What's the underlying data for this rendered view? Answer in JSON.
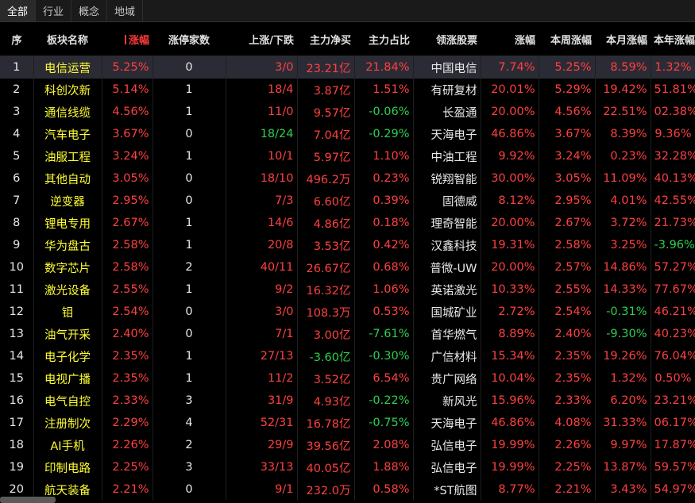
{
  "tabs": [
    {
      "label": "全部",
      "active": true
    },
    {
      "label": "行业",
      "active": false
    },
    {
      "label": "概念",
      "active": false
    },
    {
      "label": "地域",
      "active": false
    }
  ],
  "headers": [
    "序",
    "板块名称",
    "涨幅",
    "涨停家数",
    "上涨/下跌",
    "主力净买",
    "主力占比",
    "领涨股票",
    "涨幅",
    "本周涨幅",
    "本月涨幅",
    "本年涨幅"
  ],
  "rows": [
    {
      "idx": "1",
      "name": "电信运营",
      "chg": "5.25%",
      "limit": "0",
      "updown": "3/0",
      "net": "23.21亿",
      "ratio": "21.84%",
      "leader": "中国电信",
      "lchg": "7.74%",
      "week": "5.25%",
      "month": "8.59%",
      "year": "1.32%"
    },
    {
      "idx": "2",
      "name": "科创次新",
      "chg": "5.14%",
      "limit": "1",
      "updown": "18/4",
      "net": "3.87亿",
      "ratio": "1.51%",
      "leader": "有研复材",
      "lchg": "20.01%",
      "week": "5.29%",
      "month": "19.42%",
      "year": "51.81%"
    },
    {
      "idx": "3",
      "name": "通信线缆",
      "chg": "4.56%",
      "limit": "1",
      "updown": "11/0",
      "net": "9.57亿",
      "ratio": "-0.06%",
      "leader": "长盈通",
      "lchg": "20.00%",
      "week": "4.56%",
      "month": "22.51%",
      "year": "02.38%"
    },
    {
      "idx": "4",
      "name": "汽车电子",
      "chg": "3.67%",
      "limit": "0",
      "updown": "18/24",
      "net": "7.04亿",
      "ratio": "-0.29%",
      "leader": "天海电子",
      "lchg": "46.86%",
      "week": "3.67%",
      "month": "8.39%",
      "year": "9.36%"
    },
    {
      "idx": "5",
      "name": "油服工程",
      "chg": "3.24%",
      "limit": "1",
      "updown": "10/1",
      "net": "5.97亿",
      "ratio": "1.10%",
      "leader": "中油工程",
      "lchg": "9.92%",
      "week": "3.24%",
      "month": "0.23%",
      "year": "32.28%"
    },
    {
      "idx": "6",
      "name": "其他自动",
      "chg": "3.05%",
      "limit": "0",
      "updown": "18/10",
      "net": "496.2万",
      "ratio": "0.23%",
      "leader": "锐翔智能",
      "lchg": "30.00%",
      "week": "3.05%",
      "month": "11.09%",
      "year": "40.13%"
    },
    {
      "idx": "7",
      "name": "逆变器",
      "chg": "2.95%",
      "limit": "0",
      "updown": "7/3",
      "net": "6.60亿",
      "ratio": "0.39%",
      "leader": "固德威",
      "lchg": "8.12%",
      "week": "2.95%",
      "month": "4.01%",
      "year": "42.55%"
    },
    {
      "idx": "8",
      "name": "锂电专用",
      "chg": "2.67%",
      "limit": "1",
      "updown": "14/6",
      "net": "4.86亿",
      "ratio": "0.18%",
      "leader": "理奇智能",
      "lchg": "20.00%",
      "week": "2.67%",
      "month": "3.72%",
      "year": "21.73%"
    },
    {
      "idx": "9",
      "name": "华为盘古",
      "chg": "2.58%",
      "limit": "1",
      "updown": "20/8",
      "net": "3.53亿",
      "ratio": "0.42%",
      "leader": "汉鑫科技",
      "lchg": "19.31%",
      "week": "2.58%",
      "month": "3.25%",
      "year": "-3.96%"
    },
    {
      "idx": "10",
      "name": "数字芯片",
      "chg": "2.58%",
      "limit": "2",
      "updown": "40/11",
      "net": "26.67亿",
      "ratio": "0.68%",
      "leader": "普微-UW",
      "lchg": "20.00%",
      "week": "2.57%",
      "month": "14.86%",
      "year": "57.27%"
    },
    {
      "idx": "11",
      "name": "激光设备",
      "chg": "2.55%",
      "limit": "1",
      "updown": "9/2",
      "net": "16.32亿",
      "ratio": "1.06%",
      "leader": "英诺激光",
      "lchg": "10.33%",
      "week": "2.55%",
      "month": "14.33%",
      "year": "77.67%"
    },
    {
      "idx": "12",
      "name": "钼",
      "chg": "2.54%",
      "limit": "0",
      "updown": "3/0",
      "net": "108.3万",
      "ratio": "0.53%",
      "leader": "国城矿业",
      "lchg": "2.72%",
      "week": "2.54%",
      "month": "-0.31%",
      "year": "46.21%"
    },
    {
      "idx": "13",
      "name": "油气开采",
      "chg": "2.40%",
      "limit": "0",
      "updown": "7/1",
      "net": "3.00亿",
      "ratio": "-7.61%",
      "leader": "首华燃气",
      "lchg": "8.89%",
      "week": "2.40%",
      "month": "-9.30%",
      "year": "40.23%"
    },
    {
      "idx": "14",
      "name": "电子化学",
      "chg": "2.35%",
      "limit": "1",
      "updown": "27/13",
      "net": "-3.60亿",
      "ratio": "-0.30%",
      "leader": "广信材料",
      "lchg": "15.34%",
      "week": "2.35%",
      "month": "19.26%",
      "year": "76.04%"
    },
    {
      "idx": "15",
      "name": "电视广播",
      "chg": "2.35%",
      "limit": "1",
      "updown": "11/2",
      "net": "3.52亿",
      "ratio": "6.54%",
      "leader": "贵广网络",
      "lchg": "10.04%",
      "week": "2.35%",
      "month": "1.32%",
      "year": "0.50%"
    },
    {
      "idx": "16",
      "name": "电气自控",
      "chg": "2.33%",
      "limit": "3",
      "updown": "31/9",
      "net": "4.93亿",
      "ratio": "-0.22%",
      "leader": "新风光",
      "lchg": "15.96%",
      "week": "2.33%",
      "month": "6.20%",
      "year": "23.21%"
    },
    {
      "idx": "17",
      "name": "注册制次",
      "chg": "2.29%",
      "limit": "4",
      "updown": "52/31",
      "net": "16.78亿",
      "ratio": "-0.75%",
      "leader": "天海电子",
      "lchg": "46.86%",
      "week": "4.08%",
      "month": "31.33%",
      "year": "06.17%"
    },
    {
      "idx": "18",
      "name": "AI手机",
      "chg": "2.26%",
      "limit": "2",
      "updown": "29/9",
      "net": "39.56亿",
      "ratio": "2.08%",
      "leader": "弘信电子",
      "lchg": "19.99%",
      "week": "2.26%",
      "month": "9.97%",
      "year": "17.87%"
    },
    {
      "idx": "19",
      "name": "印制电路",
      "chg": "2.25%",
      "limit": "3",
      "updown": "33/13",
      "net": "40.05亿",
      "ratio": "1.88%",
      "leader": "弘信电子",
      "lchg": "19.99%",
      "week": "2.25%",
      "month": "13.87%",
      "year": "59.57%"
    },
    {
      "idx": "20",
      "name": "航天装备",
      "chg": "2.21%",
      "limit": "0",
      "updown": "9/1",
      "net": "232.0万",
      "ratio": "0.58%",
      "leader": "*ST航图",
      "lchg": "8.77%",
      "week": "2.21%",
      "month": "3.43%",
      "year": "54.97%"
    }
  ],
  "colors": {
    "up": "#ff4040",
    "down": "#2dd04f",
    "name": "#ffff33",
    "selected_bg": "#2b2b36",
    "sorted_header": "#ff3b3b"
  }
}
